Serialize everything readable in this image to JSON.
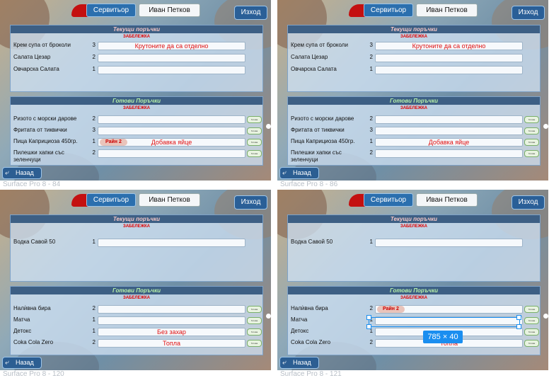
{
  "screens": [
    {
      "caption": "Surface Pro 8 - 84",
      "waiter_label": "Сервитьор",
      "user_name": "Иван Петков",
      "exit_label": "Изход",
      "current_title": "Текущи поръчки",
      "current_note": "ЗАБЕЛЕЖКА",
      "current_items": [
        {
          "name": "Крем супа от броколи",
          "qty": "3",
          "note": "Крутоните да са отделно"
        },
        {
          "name": "Салата Цезар",
          "qty": "2",
          "note": ""
        },
        {
          "name": "Овчарска Салата",
          "qty": "1",
          "note": ""
        }
      ],
      "ready_title": "Готови Поръчки",
      "ready_note": "ЗАБЕЛЕЖКА",
      "ready_items": [
        {
          "name": "Ризото с морски дарове",
          "qty": "2",
          "note": "",
          "tag": ""
        },
        {
          "name": "Фритата от тиквички",
          "qty": "3",
          "note": "",
          "tag": ""
        },
        {
          "name": "Пица Каприциоза 450гр.",
          "qty": "1",
          "note": "Добавка яйце",
          "tag": "Райн 2"
        },
        {
          "name": "Пилешки хапки със зеленчуци",
          "qty": "2",
          "note": "",
          "tag": ""
        }
      ],
      "back_label": "Назад"
    },
    {
      "caption": "Surface Pro 8 - 86",
      "waiter_label": "Сервитьор",
      "user_name": "Иван Петков",
      "exit_label": "Изход",
      "current_title": "Текущи поръчки",
      "current_note": "ЗАБЕЛЕЖКА",
      "current_items": [
        {
          "name": "Крем супа от броколи",
          "qty": "3",
          "note": "Крутоните да са отделно"
        },
        {
          "name": "Салата Цезар",
          "qty": "2",
          "note": ""
        },
        {
          "name": "Овчарска Салата",
          "qty": "1",
          "note": ""
        }
      ],
      "ready_title": "Готови Поръчки",
      "ready_note": "ЗАБЕЛЕЖКА",
      "ready_items": [
        {
          "name": "Ризото с морски дарове",
          "qty": "2",
          "note": "",
          "tag": ""
        },
        {
          "name": "Фритата от тиквички",
          "qty": "3",
          "note": "",
          "tag": ""
        },
        {
          "name": "Пица Каприциоза 450гр.",
          "qty": "1",
          "note": "Добавка яйце",
          "tag": ""
        },
        {
          "name": "Пилешки хапки със зеленчуци",
          "qty": "2",
          "note": "",
          "tag": ""
        }
      ],
      "back_label": "Назад"
    },
    {
      "caption": "Surface Pro 8 - 120",
      "waiter_label": "Сервитьор",
      "user_name": "Иван Петков",
      "exit_label": "Изход",
      "current_title": "Текущи поръчки",
      "current_note": "ЗАБЕЛЕЖКА",
      "current_items": [
        {
          "name": "Водка Савой 50",
          "qty": "1",
          "note": ""
        }
      ],
      "ready_title": "Готови Поръчки",
      "ready_note": "ЗАБЕЛЕЖКА",
      "ready_items": [
        {
          "name": "Налѝвна бира",
          "qty": "2",
          "note": "",
          "tag": ""
        },
        {
          "name": "Матча",
          "qty": "1",
          "note": "",
          "tag": ""
        },
        {
          "name": "Детокс",
          "qty": "1",
          "note": "Без захар",
          "tag": ""
        },
        {
          "name": "Coka Cola Zero",
          "qty": "2",
          "note": "Топла",
          "tag": ""
        }
      ],
      "back_label": "Назад"
    },
    {
      "caption": "Surface Pro 8 - 121",
      "waiter_label": "Сервитьор",
      "user_name": "Иван Петков",
      "exit_label": "Изход",
      "current_title": "Текущи поръчки",
      "current_note": "ЗАБЕЛЕЖКА",
      "current_items": [
        {
          "name": "Водка Савой 50",
          "qty": "1",
          "note": ""
        }
      ],
      "ready_title": "Готови Поръчки",
      "ready_note": "ЗАБЕЛЕЖКА",
      "ready_items": [
        {
          "name": "Налѝвна бира",
          "qty": "2",
          "note": "",
          "tag": "Райн 2"
        },
        {
          "name": "Матча",
          "qty": "1",
          "note": "",
          "tag": ""
        },
        {
          "name": "Детокс",
          "qty": "1",
          "note": "",
          "tag": ""
        },
        {
          "name": "Coka Cola Zero",
          "qty": "2",
          "note": "Топла",
          "tag": ""
        }
      ],
      "back_label": "Назад"
    }
  ],
  "ready_button_text": "Готова",
  "selection_size": "785 × 40",
  "colors": {
    "accent": "#2b6fae",
    "note_red": "#e00000",
    "selection_blue": "#1a8ef0"
  }
}
